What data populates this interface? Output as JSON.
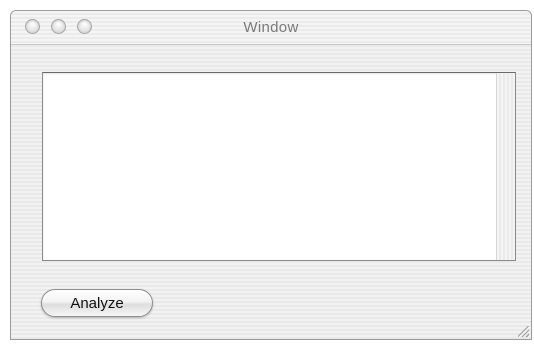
{
  "window": {
    "title": "Window"
  },
  "text_area": {
    "value": ""
  },
  "buttons": {
    "analyze_label": "Analyze"
  },
  "icons": {
    "close": "close-traffic-light-icon",
    "minimize": "minimize-traffic-light-icon",
    "zoom": "zoom-traffic-light-icon",
    "resize": "resize-grip-icon"
  }
}
